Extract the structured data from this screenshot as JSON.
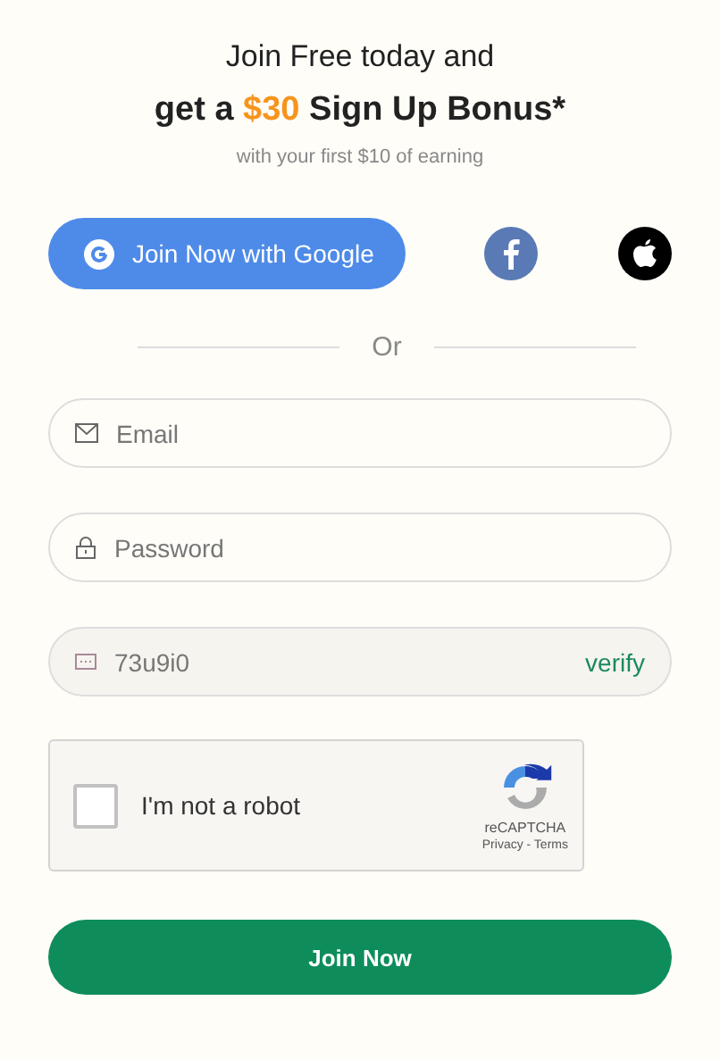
{
  "heading": {
    "line1": "Join Free today and",
    "line2": "get a **$30** Sign Up Bonus*",
    "subtitle": "with your first $10 of earning"
  },
  "social": [
    {
      "kind": "google",
      "label": "Join Now with Google"
    },
    {
      "kind": "facebook"
    },
    {
      "kind": "apple"
    }
  ],
  "divider": "Or",
  "fields": [
    {
      "kind": "email",
      "placeholder": "Email"
    },
    {
      "kind": "password",
      "placeholder": "Password"
    },
    {
      "kind": "captcha",
      "value": "73u9i0",
      "action": "verify"
    }
  ],
  "recaptcha": {
    "checked": false,
    "label": "I'm not a robot",
    "brand": "reCAPTCHA",
    "links": "Privacy - Terms"
  },
  "submit": "Join Now"
}
